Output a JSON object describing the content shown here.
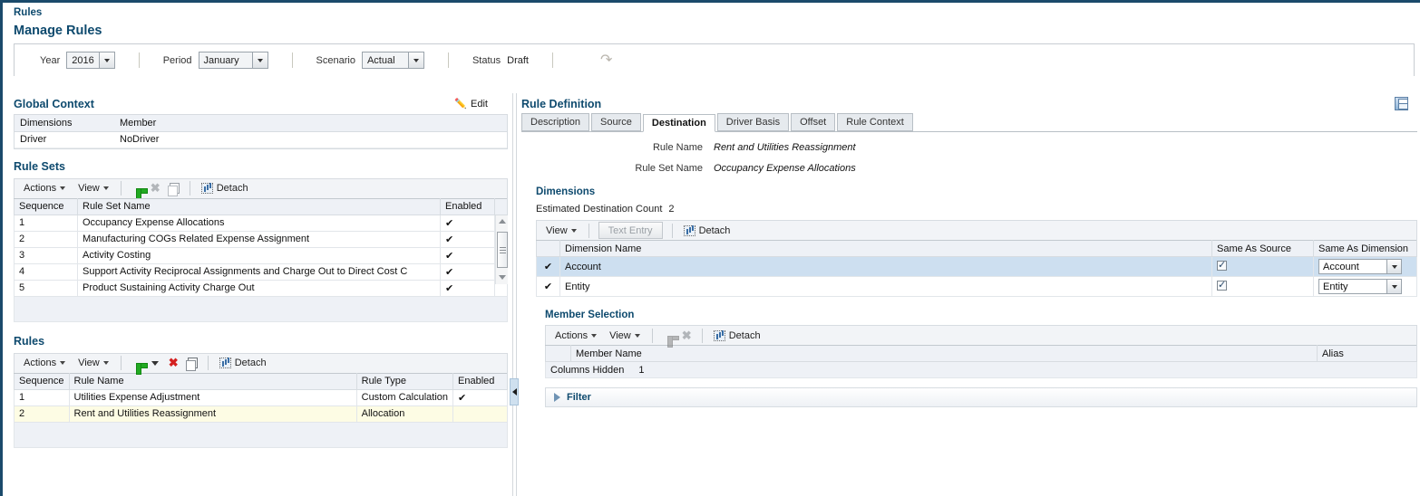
{
  "breadcrumb": "Rules",
  "page_title": "Manage Rules",
  "context_bar": {
    "year_label": "Year",
    "year_value": "2016",
    "period_label": "Period",
    "period_value": "January",
    "scenario_label": "Scenario",
    "scenario_value": "Actual",
    "status_label": "Status",
    "status_value": "Draft",
    "redo_icon": "redo-icon"
  },
  "global_context": {
    "title": "Global Context",
    "edit_label": "Edit",
    "edit_icon": "pencil-icon",
    "columns": [
      "Dimensions",
      "Member"
    ],
    "rows": [
      {
        "dimension": "Driver",
        "member": "NoDriver"
      }
    ]
  },
  "rule_sets": {
    "title": "Rule Sets",
    "toolbar": {
      "actions_label": "Actions",
      "view_label": "View",
      "add_icon": "plus-icon",
      "delete_icon": "x-delete-icon",
      "copy_icon": "copy-icon",
      "detach_label": "Detach",
      "detach_icon": "detach-icon"
    },
    "columns": [
      "Sequence",
      "Rule Set Name",
      "Enabled"
    ],
    "rows": [
      {
        "sequence": "1",
        "name": "Occupancy Expense Allocations",
        "enabled": "✔"
      },
      {
        "sequence": "2",
        "name": "Manufacturing COGs Related Expense Assignment",
        "enabled": "✔"
      },
      {
        "sequence": "3",
        "name": "Activity Costing",
        "enabled": "✔"
      },
      {
        "sequence": "4",
        "name": "Support Activity Reciprocal Assignments and Charge Out to Direct Cost C",
        "enabled": "✔"
      },
      {
        "sequence": "5",
        "name": "Product Sustaining Activity Charge Out",
        "enabled": "✔"
      }
    ]
  },
  "rules": {
    "title": "Rules",
    "toolbar": {
      "actions_label": "Actions",
      "view_label": "View",
      "add_icon": "plus-icon",
      "add_dropdown_icon": "caret-down-icon",
      "delete_icon": "x-delete-icon",
      "copy_icon": "copy-icon",
      "detach_label": "Detach",
      "detach_icon": "detach-icon"
    },
    "columns": [
      "Sequence",
      "Rule Name",
      "Rule Type",
      "Enabled"
    ],
    "rows": [
      {
        "sequence": "1",
        "name": "Utilities Expense Adjustment",
        "type": "Custom Calculation",
        "enabled": "✔",
        "selected": false
      },
      {
        "sequence": "2",
        "name": "Rent and Utilities Reassignment",
        "type": "Allocation",
        "enabled": "",
        "selected": true
      }
    ]
  },
  "rule_definition": {
    "title": "Rule Definition",
    "save_icon": "save-icon",
    "tabs": [
      {
        "label": "Description",
        "active": false
      },
      {
        "label": "Source",
        "active": false
      },
      {
        "label": "Destination",
        "active": true
      },
      {
        "label": "Driver Basis",
        "active": false
      },
      {
        "label": "Offset",
        "active": false
      },
      {
        "label": "Rule Context",
        "active": false
      }
    ],
    "rule_name_label": "Rule Name",
    "rule_name_value": "Rent and Utilities Reassignment",
    "rule_set_name_label": "Rule Set Name",
    "rule_set_name_value": "Occupancy Expense Allocations"
  },
  "dimensions": {
    "title": "Dimensions",
    "estimated_label": "Estimated Destination Count",
    "estimated_value": "2",
    "toolbar": {
      "view_label": "View",
      "text_entry_label": "Text Entry",
      "detach_label": "Detach",
      "detach_icon": "detach-icon"
    },
    "columns": [
      "",
      "Dimension Name",
      "Same As Source",
      "Same As Dimension"
    ],
    "rows": [
      {
        "check": "✔",
        "name": "Account",
        "same_as_source": true,
        "same_as_dimension": "Account",
        "selected": true
      },
      {
        "check": "✔",
        "name": "Entity",
        "same_as_source": true,
        "same_as_dimension": "Entity",
        "selected": false
      }
    ]
  },
  "member_selection": {
    "title": "Member Selection",
    "toolbar": {
      "actions_label": "Actions",
      "view_label": "View",
      "add_icon": "plus-icon",
      "delete_icon": "x-delete-icon",
      "detach_label": "Detach",
      "detach_icon": "detach-icon"
    },
    "columns": [
      "",
      "Member Name",
      "Alias"
    ],
    "columns_hidden_label": "Columns Hidden",
    "columns_hidden_value": "1"
  },
  "filter": {
    "label": "Filter",
    "expand_icon": "triangle-right-icon"
  },
  "colors": {
    "brand_navy": "#1b4a6b",
    "heading_blue": "#0e4a6e",
    "selected_row_yellow": "#fdfce4",
    "selected_row_blue": "#cddff0",
    "header_grey": "#eef1f6",
    "add_green": "#22aa22",
    "delete_red": "#d42020"
  }
}
